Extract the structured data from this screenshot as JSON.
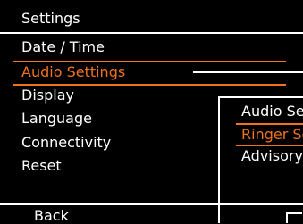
{
  "header": {
    "title": "Settings"
  },
  "menu": {
    "items": [
      {
        "label": "Date / Time"
      },
      {
        "label": "Audio Settings"
      },
      {
        "label": "Display"
      },
      {
        "label": "Language"
      },
      {
        "label": "Connectivity"
      },
      {
        "label": "Reset"
      }
    ],
    "selected_index": 1
  },
  "submenu": {
    "items": [
      {
        "label": "Audio Se"
      },
      {
        "label": "Ringer Se"
      },
      {
        "label": "Advisory"
      }
    ],
    "selected_index": 1
  },
  "softkeys": {
    "left": "Back"
  },
  "colors": {
    "accent": "#f0731c",
    "background": "#000000",
    "text": "#ffffff"
  }
}
